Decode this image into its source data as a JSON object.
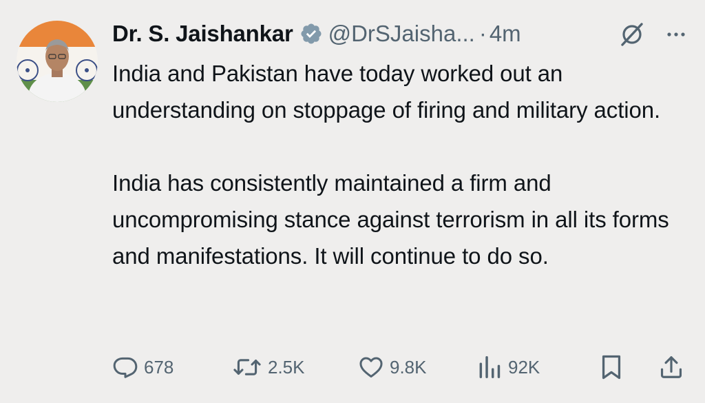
{
  "author": {
    "name": "Dr. S. Jaishankar",
    "handle": "@DrSJaisha...",
    "separator": "·",
    "time": "4m",
    "verified_badge_color": "#829aab"
  },
  "tweet": {
    "paragraphs": [
      "India and Pakistan have today worked out an understanding on stoppage of firing and military action.",
      "India has consistently maintained a firm and uncompromising stance against terrorism in all its forms and manifestations. It will continue to do so."
    ]
  },
  "actions": {
    "replies": "678",
    "reposts": "2.5K",
    "likes": "9.8K",
    "views": "92K"
  },
  "icons": {
    "reply": "reply-icon",
    "repost": "repost-icon",
    "like": "like-icon",
    "views": "views-icon",
    "bookmark": "bookmark-icon",
    "share": "share-icon",
    "grok": "grok-icon",
    "more": "more-icon"
  },
  "colors": {
    "background": "#efeeed",
    "text": "#0f1419",
    "secondary": "#536471"
  }
}
